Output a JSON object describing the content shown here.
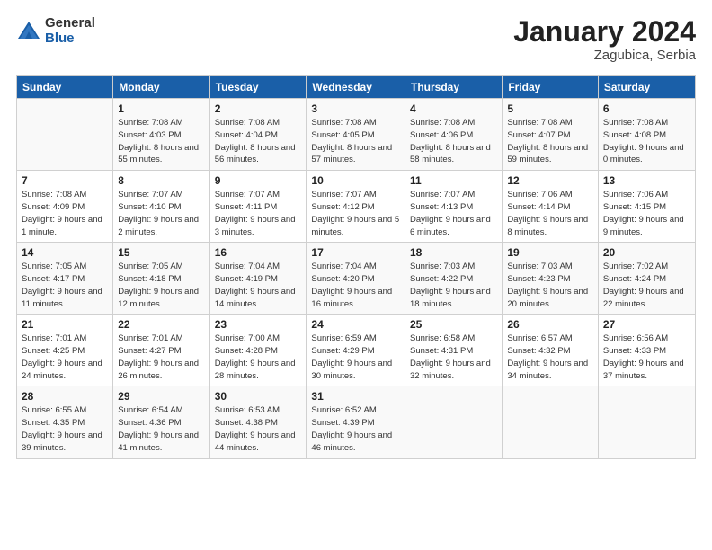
{
  "logo": {
    "general": "General",
    "blue": "Blue"
  },
  "calendar": {
    "title": "January 2024",
    "subtitle": "Zagubica, Serbia"
  },
  "headers": [
    "Sunday",
    "Monday",
    "Tuesday",
    "Wednesday",
    "Thursday",
    "Friday",
    "Saturday"
  ],
  "weeks": [
    [
      {
        "num": "",
        "sunrise": "",
        "sunset": "",
        "daylight": ""
      },
      {
        "num": "1",
        "sunrise": "Sunrise: 7:08 AM",
        "sunset": "Sunset: 4:03 PM",
        "daylight": "Daylight: 8 hours and 55 minutes."
      },
      {
        "num": "2",
        "sunrise": "Sunrise: 7:08 AM",
        "sunset": "Sunset: 4:04 PM",
        "daylight": "Daylight: 8 hours and 56 minutes."
      },
      {
        "num": "3",
        "sunrise": "Sunrise: 7:08 AM",
        "sunset": "Sunset: 4:05 PM",
        "daylight": "Daylight: 8 hours and 57 minutes."
      },
      {
        "num": "4",
        "sunrise": "Sunrise: 7:08 AM",
        "sunset": "Sunset: 4:06 PM",
        "daylight": "Daylight: 8 hours and 58 minutes."
      },
      {
        "num": "5",
        "sunrise": "Sunrise: 7:08 AM",
        "sunset": "Sunset: 4:07 PM",
        "daylight": "Daylight: 8 hours and 59 minutes."
      },
      {
        "num": "6",
        "sunrise": "Sunrise: 7:08 AM",
        "sunset": "Sunset: 4:08 PM",
        "daylight": "Daylight: 9 hours and 0 minutes."
      }
    ],
    [
      {
        "num": "7",
        "sunrise": "Sunrise: 7:08 AM",
        "sunset": "Sunset: 4:09 PM",
        "daylight": "Daylight: 9 hours and 1 minute."
      },
      {
        "num": "8",
        "sunrise": "Sunrise: 7:07 AM",
        "sunset": "Sunset: 4:10 PM",
        "daylight": "Daylight: 9 hours and 2 minutes."
      },
      {
        "num": "9",
        "sunrise": "Sunrise: 7:07 AM",
        "sunset": "Sunset: 4:11 PM",
        "daylight": "Daylight: 9 hours and 3 minutes."
      },
      {
        "num": "10",
        "sunrise": "Sunrise: 7:07 AM",
        "sunset": "Sunset: 4:12 PM",
        "daylight": "Daylight: 9 hours and 5 minutes."
      },
      {
        "num": "11",
        "sunrise": "Sunrise: 7:07 AM",
        "sunset": "Sunset: 4:13 PM",
        "daylight": "Daylight: 9 hours and 6 minutes."
      },
      {
        "num": "12",
        "sunrise": "Sunrise: 7:06 AM",
        "sunset": "Sunset: 4:14 PM",
        "daylight": "Daylight: 9 hours and 8 minutes."
      },
      {
        "num": "13",
        "sunrise": "Sunrise: 7:06 AM",
        "sunset": "Sunset: 4:15 PM",
        "daylight": "Daylight: 9 hours and 9 minutes."
      }
    ],
    [
      {
        "num": "14",
        "sunrise": "Sunrise: 7:05 AM",
        "sunset": "Sunset: 4:17 PM",
        "daylight": "Daylight: 9 hours and 11 minutes."
      },
      {
        "num": "15",
        "sunrise": "Sunrise: 7:05 AM",
        "sunset": "Sunset: 4:18 PM",
        "daylight": "Daylight: 9 hours and 12 minutes."
      },
      {
        "num": "16",
        "sunrise": "Sunrise: 7:04 AM",
        "sunset": "Sunset: 4:19 PM",
        "daylight": "Daylight: 9 hours and 14 minutes."
      },
      {
        "num": "17",
        "sunrise": "Sunrise: 7:04 AM",
        "sunset": "Sunset: 4:20 PM",
        "daylight": "Daylight: 9 hours and 16 minutes."
      },
      {
        "num": "18",
        "sunrise": "Sunrise: 7:03 AM",
        "sunset": "Sunset: 4:22 PM",
        "daylight": "Daylight: 9 hours and 18 minutes."
      },
      {
        "num": "19",
        "sunrise": "Sunrise: 7:03 AM",
        "sunset": "Sunset: 4:23 PM",
        "daylight": "Daylight: 9 hours and 20 minutes."
      },
      {
        "num": "20",
        "sunrise": "Sunrise: 7:02 AM",
        "sunset": "Sunset: 4:24 PM",
        "daylight": "Daylight: 9 hours and 22 minutes."
      }
    ],
    [
      {
        "num": "21",
        "sunrise": "Sunrise: 7:01 AM",
        "sunset": "Sunset: 4:25 PM",
        "daylight": "Daylight: 9 hours and 24 minutes."
      },
      {
        "num": "22",
        "sunrise": "Sunrise: 7:01 AM",
        "sunset": "Sunset: 4:27 PM",
        "daylight": "Daylight: 9 hours and 26 minutes."
      },
      {
        "num": "23",
        "sunrise": "Sunrise: 7:00 AM",
        "sunset": "Sunset: 4:28 PM",
        "daylight": "Daylight: 9 hours and 28 minutes."
      },
      {
        "num": "24",
        "sunrise": "Sunrise: 6:59 AM",
        "sunset": "Sunset: 4:29 PM",
        "daylight": "Daylight: 9 hours and 30 minutes."
      },
      {
        "num": "25",
        "sunrise": "Sunrise: 6:58 AM",
        "sunset": "Sunset: 4:31 PM",
        "daylight": "Daylight: 9 hours and 32 minutes."
      },
      {
        "num": "26",
        "sunrise": "Sunrise: 6:57 AM",
        "sunset": "Sunset: 4:32 PM",
        "daylight": "Daylight: 9 hours and 34 minutes."
      },
      {
        "num": "27",
        "sunrise": "Sunrise: 6:56 AM",
        "sunset": "Sunset: 4:33 PM",
        "daylight": "Daylight: 9 hours and 37 minutes."
      }
    ],
    [
      {
        "num": "28",
        "sunrise": "Sunrise: 6:55 AM",
        "sunset": "Sunset: 4:35 PM",
        "daylight": "Daylight: 9 hours and 39 minutes."
      },
      {
        "num": "29",
        "sunrise": "Sunrise: 6:54 AM",
        "sunset": "Sunset: 4:36 PM",
        "daylight": "Daylight: 9 hours and 41 minutes."
      },
      {
        "num": "30",
        "sunrise": "Sunrise: 6:53 AM",
        "sunset": "Sunset: 4:38 PM",
        "daylight": "Daylight: 9 hours and 44 minutes."
      },
      {
        "num": "31",
        "sunrise": "Sunrise: 6:52 AM",
        "sunset": "Sunset: 4:39 PM",
        "daylight": "Daylight: 9 hours and 46 minutes."
      },
      {
        "num": "",
        "sunrise": "",
        "sunset": "",
        "daylight": ""
      },
      {
        "num": "",
        "sunrise": "",
        "sunset": "",
        "daylight": ""
      },
      {
        "num": "",
        "sunrise": "",
        "sunset": "",
        "daylight": ""
      }
    ]
  ]
}
